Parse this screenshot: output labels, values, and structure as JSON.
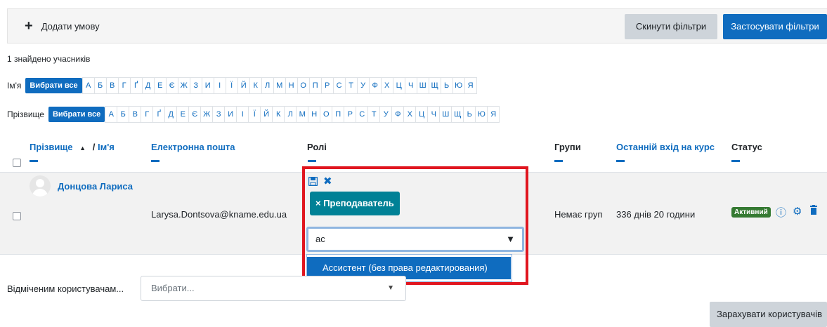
{
  "filters": {
    "add_condition": "Додати умову",
    "reset_label": "Скинути фільтри",
    "apply_label": "Застосувати фільтри"
  },
  "found_text": "1 знайдено учасників",
  "first_name_filter": {
    "label": "Ім'я",
    "select_all": "Вибрати все",
    "letters": [
      "А",
      "Б",
      "В",
      "Г",
      "Ґ",
      "Д",
      "Е",
      "Є",
      "Ж",
      "З",
      "И",
      "І",
      "Ї",
      "Й",
      "К",
      "Л",
      "М",
      "Н",
      "О",
      "П",
      "Р",
      "С",
      "Т",
      "У",
      "Ф",
      "Х",
      "Ц",
      "Ч",
      "Ш",
      "Щ",
      "Ь",
      "Ю",
      "Я"
    ]
  },
  "last_name_filter": {
    "label": "Прізвище",
    "select_all": "Вибрати все",
    "letters": [
      "А",
      "Б",
      "В",
      "Г",
      "Ґ",
      "Д",
      "Е",
      "Є",
      "Ж",
      "З",
      "И",
      "І",
      "Ї",
      "Й",
      "К",
      "Л",
      "М",
      "Н",
      "О",
      "П",
      "Р",
      "С",
      "Т",
      "У",
      "Ф",
      "Х",
      "Ц",
      "Ч",
      "Ш",
      "Щ",
      "Ь",
      "Ю",
      "Я"
    ]
  },
  "table": {
    "col_lastname": "Прізвище",
    "sort_indicator": "▲",
    "col_separator": "/",
    "col_firstname": "Ім'я",
    "col_email": "Електронна пошта",
    "col_roles": "Ролі",
    "col_groups": "Групи",
    "col_last_access": "Останній вхід на курс",
    "col_status": "Статус",
    "row": {
      "name": "Донцова Лариса",
      "email": "Larysa.Dontsova@kname.edu.ua",
      "groups": "Немає груп",
      "last_access": "336 днів 20 години",
      "status": "Активний"
    }
  },
  "roles_editor": {
    "role_chip": "× Преподаватель",
    "input_value": "ас",
    "suggestion": "Ассистент (без права редактирования)"
  },
  "bulk": {
    "label": "Відміченим користувачам...",
    "select_placeholder": "Вибрати...",
    "enrol_label": "Зарахувати користувачів"
  },
  "colors": {
    "primary": "#0f6cbf",
    "role_chip": "#008196",
    "active_badge": "#357a32",
    "highlight_frame": "#e0161f"
  }
}
